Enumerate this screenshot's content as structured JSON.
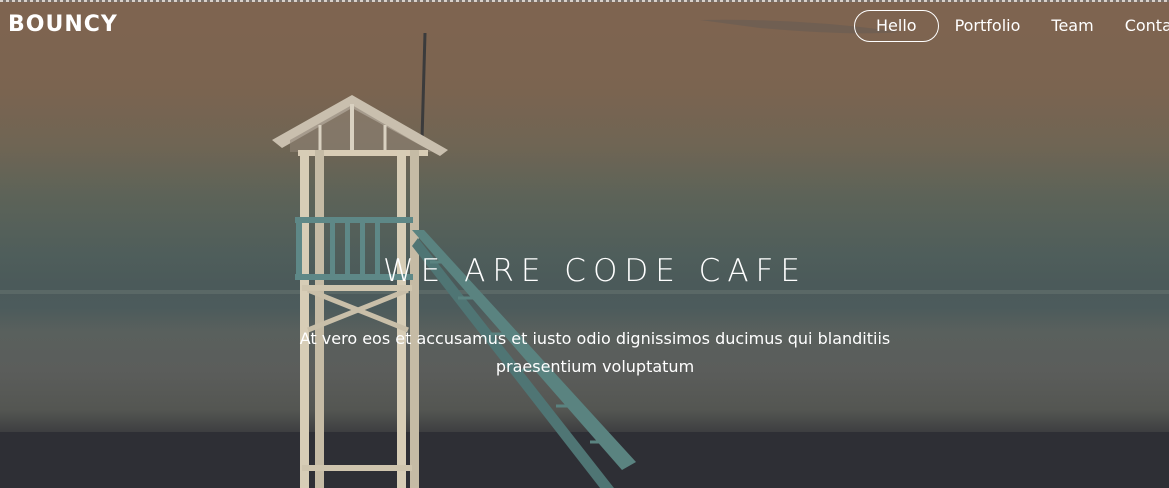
{
  "brand": {
    "logo_text": "BOUNCY"
  },
  "nav": {
    "items": [
      {
        "label": "Hello",
        "active": true
      },
      {
        "label": "Portfolio",
        "active": false
      },
      {
        "label": "Team",
        "active": false
      },
      {
        "label": "Contact",
        "active": false
      }
    ]
  },
  "hero": {
    "headline": "WE ARE CODE CAFE",
    "subtext": "At vero eos et accusamus et iusto odio dignissimos ducimus qui blanditiis praesentium voluptatum",
    "background_scene": "lifeguard-tower-beach-icon"
  },
  "colors": {
    "text": "#ffffff",
    "sky": "#7f6450",
    "sea": "#4c5b5c",
    "sand": "#2f3036"
  }
}
